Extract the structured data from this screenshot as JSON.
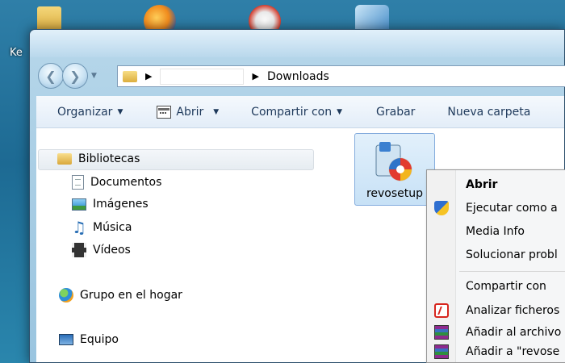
{
  "desktop": {
    "label_fragment": "Ke",
    "icons": [
      "folder-icon",
      "firefox-icon",
      "ccleaner-icon",
      "visual-studio-icon"
    ]
  },
  "window": {
    "address": {
      "breadcrumbs": [
        "",
        "Downloads"
      ]
    },
    "toolbar": {
      "organize": "Organizar",
      "open": "Abrir",
      "share": "Compartir con",
      "burn": "Grabar",
      "new_folder": "Nueva carpeta"
    },
    "navigation": {
      "libraries": "Bibliotecas",
      "documents": "Documentos",
      "images": "Imágenes",
      "music": "Música",
      "videos": "Vídeos",
      "homegroup": "Grupo en el hogar",
      "computer": "Equipo"
    },
    "files": [
      {
        "name": "revosetup",
        "selected": true
      }
    ]
  },
  "context_menu": {
    "open": "Abrir",
    "run_as": "Ejecutar como a",
    "media_info": "Media Info",
    "troubleshoot": "Solucionar probl",
    "share_with": "Compartir con",
    "scan": "Analizar ficheros",
    "add_archive": "Añadir al archivo",
    "add_named": "Añadir a \"revose"
  },
  "colors": {
    "accent": "#1e395b",
    "selection": "#c7e1f6",
    "desktop": "#1d6a93"
  }
}
